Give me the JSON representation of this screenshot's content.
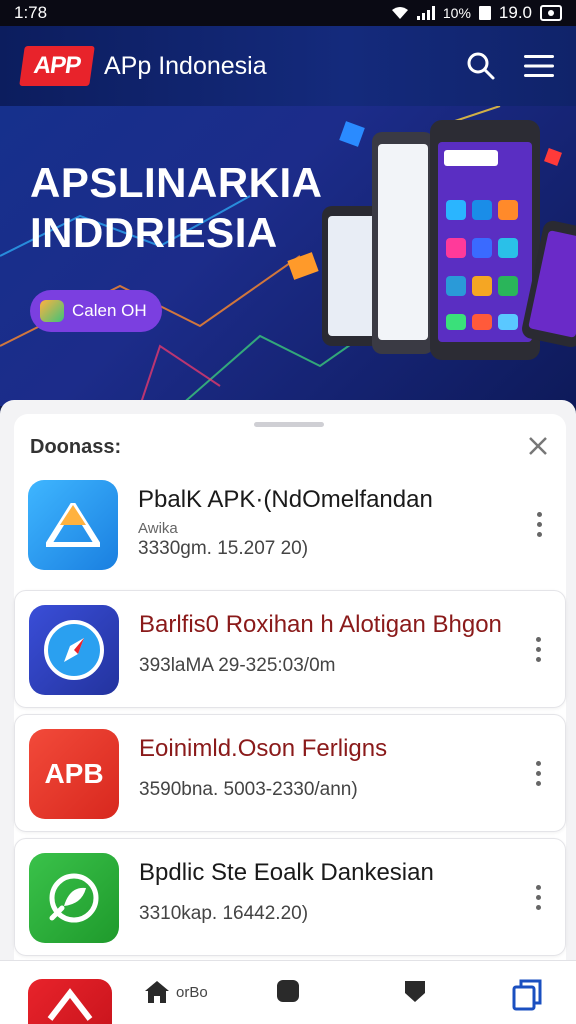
{
  "status_bar": {
    "time": "1:78",
    "battery_text": "10%",
    "clock": "19.0"
  },
  "header": {
    "logo": "APP",
    "title": "APp Indonesia",
    "icons": [
      "search-icon",
      "hamburger-menu-icon"
    ]
  },
  "hero": {
    "title_line1": "APSLINARKIA",
    "title_line2": "INDDRIESIA",
    "cta_label": "Calen OH"
  },
  "sheet": {
    "title": "Doonass:",
    "apps": [
      {
        "name": "PbalK APK·(NdOmelfandan",
        "sub": "Awika",
        "meta": "3330gm. 15.207 20)",
        "icon": "triangle-app-icon",
        "icon_color": "#1e8de8"
      },
      {
        "name": "Barlfis0 Roxihan h Alotigan Bhgon",
        "meta": "393laMA 29-325:03/0m",
        "icon": "compass-app-icon",
        "icon_color": "#2f46c2"
      },
      {
        "name": "Eoinimld.Oson Ferligns",
        "meta": "3590bna. 5003-2330/ann)",
        "icon": "apb-app-icon",
        "icon_label": "APB",
        "icon_color": "#e53a2a"
      },
      {
        "name": "Bpdlic Ste Eoalk Dankesian",
        "meta": "3310kap. 16442.20)",
        "icon": "leaf-chat-app-icon",
        "icon_color": "#2fae3a"
      }
    ]
  },
  "bottom_nav": {
    "home_label": "orBo",
    "items": [
      "app-shortcut-icon",
      "home-icon",
      "square-icon",
      "shield-icon",
      "copy-icon"
    ]
  }
}
